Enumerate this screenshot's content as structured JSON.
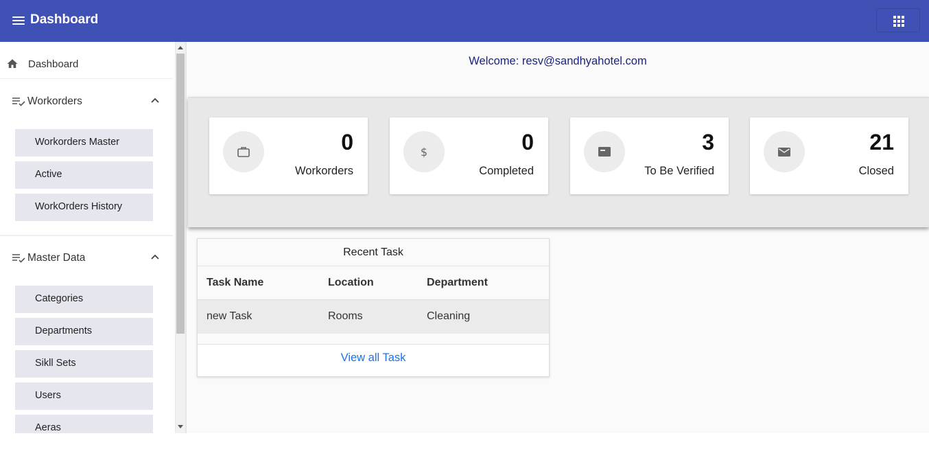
{
  "header": {
    "title": "Dashboard",
    "menu_icon": "hamburger-menu-icon",
    "apps_icon": "apps-grid-icon",
    "color": "#3f51b5"
  },
  "sidebar": {
    "dashboard": {
      "label": "Dashboard",
      "icon": "home-icon"
    },
    "groups": [
      {
        "label": "Workorders",
        "icon": "playlist-check-icon",
        "expanded": true,
        "items": [
          {
            "label": "Workorders Master"
          },
          {
            "label": "Active"
          },
          {
            "label": "WorkOrders History"
          }
        ]
      },
      {
        "label": "Master Data",
        "icon": "playlist-check-icon",
        "expanded": true,
        "items": [
          {
            "label": "Categories"
          },
          {
            "label": "Departments"
          },
          {
            "label": "Sikll Sets"
          },
          {
            "label": "Users"
          },
          {
            "label": "Aeras"
          }
        ]
      }
    ]
  },
  "main": {
    "welcome": "Welcome: resv@sandhyahotel.com",
    "stats": [
      {
        "value": "0",
        "label": "Workorders",
        "icon": "briefcase-icon"
      },
      {
        "value": "0",
        "label": "Completed",
        "icon": "dollar-icon"
      },
      {
        "value": "3",
        "label": "To Be Verified",
        "icon": "card-icon"
      },
      {
        "value": "21",
        "label": "Closed",
        "icon": "mail-icon"
      }
    ],
    "recent_task": {
      "title": "Recent Task",
      "columns": [
        "Task Name",
        "Location",
        "Department"
      ],
      "rows": [
        [
          "new Task",
          "Rooms",
          "Cleaning"
        ]
      ],
      "view_all": "View all Task"
    }
  }
}
